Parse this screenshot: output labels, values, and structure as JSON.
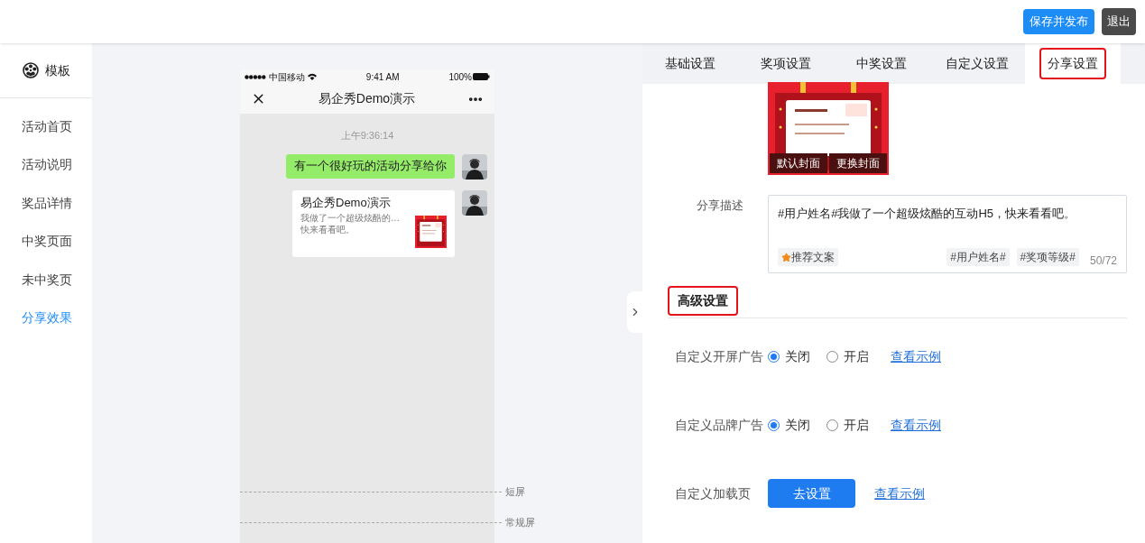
{
  "header": {
    "buttons": [
      {
        "label": "保存并发布",
        "kind": "primary"
      },
      {
        "label": "退出",
        "kind": "dark"
      }
    ]
  },
  "sidebar": {
    "title": "模板",
    "items": [
      {
        "label": "活动首页",
        "selected": false
      },
      {
        "label": "活动说明",
        "selected": false
      },
      {
        "label": "奖品详情",
        "selected": false
      },
      {
        "label": "中奖页面",
        "selected": false
      },
      {
        "label": "未中奖页",
        "selected": false
      },
      {
        "label": "分享效果",
        "selected": true
      }
    ]
  },
  "phone": {
    "status_bar": {
      "carrier": "中国移动",
      "time": "9:41 AM",
      "battery": "100%"
    },
    "nav_title": "易企秀Demo演示",
    "messages": [
      {
        "kind": "timestamp",
        "text": "上午9:36:14"
      },
      {
        "kind": "text",
        "text": "有一个很好玩的活动分享给你"
      },
      {
        "kind": "card",
        "title": "易企秀Demo演示",
        "lines": [
          "我做了一个超级炫酷的…",
          "快来看看吧。"
        ]
      }
    ],
    "screen_markers": [
      {
        "label": "短屏"
      },
      {
        "label": "常规屏"
      }
    ]
  },
  "tabs": [
    {
      "label": "基础设置",
      "selected": false,
      "highlighted": false
    },
    {
      "label": "奖项设置",
      "selected": false,
      "highlighted": false
    },
    {
      "label": "中奖设置",
      "selected": false,
      "highlighted": false
    },
    {
      "label": "自定义设置",
      "selected": false,
      "highlighted": false
    },
    {
      "label": "分享设置",
      "selected": true,
      "highlighted": true
    }
  ],
  "share": {
    "cover_buttons": [
      "默认封面",
      "更换封面"
    ],
    "description_label": "分享描述",
    "description": {
      "value": "#用户姓名#我做了一个超级炫酷的互动H5，快来看看吧。",
      "suggest": "推荐文案",
      "tags": [
        "#用户姓名#",
        "#奖项等级#"
      ],
      "counter": "50/72"
    }
  },
  "advanced": {
    "title": "高级设置",
    "highlighted": true,
    "rows": [
      {
        "kind": "radio",
        "label": "自定义开屏广告",
        "options": [
          {
            "label": "关闭",
            "selected": true
          },
          {
            "label": "开启",
            "selected": false
          }
        ],
        "link": "查看示例"
      },
      {
        "kind": "radio",
        "label": "自定义品牌广告",
        "options": [
          {
            "label": "关闭",
            "selected": true
          },
          {
            "label": "开启",
            "selected": false
          }
        ],
        "link": "查看示例"
      },
      {
        "kind": "button",
        "label": "自定义加载页",
        "button": "去设置",
        "link": "查看示例"
      }
    ]
  }
}
